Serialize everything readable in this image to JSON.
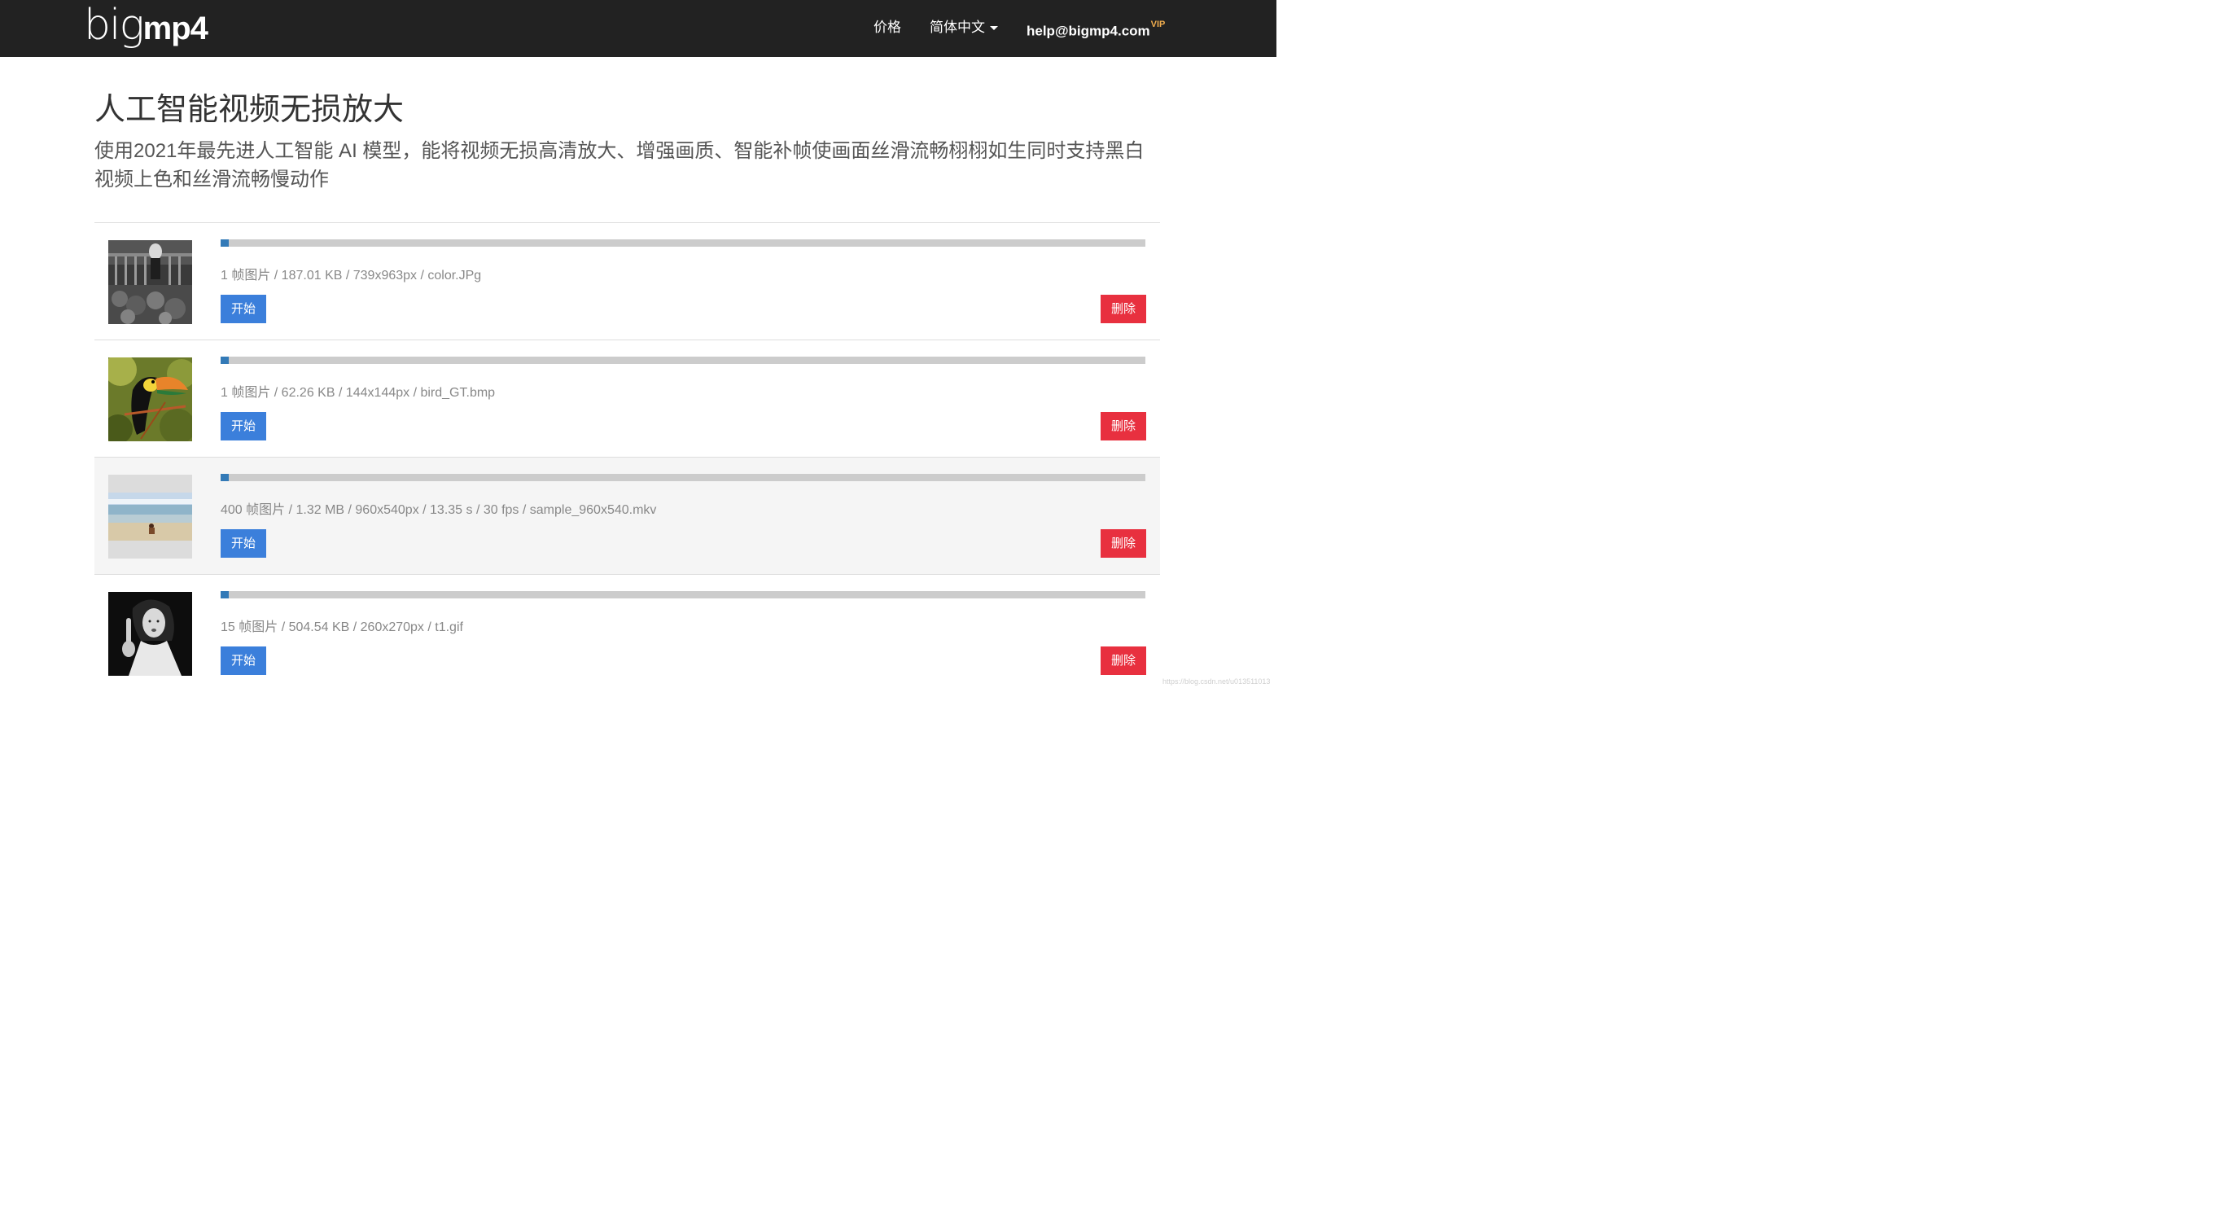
{
  "header": {
    "logo_light": "big",
    "logo_bold": "mp4",
    "nav_price": "价格",
    "nav_language": "简体中文",
    "nav_email": "help@bigmp4.com",
    "nav_email_badge": "VIP"
  },
  "main": {
    "title": "人工智能视频无损放大",
    "subtitle": "使用2021年最先进人工智能 AI 模型，能将视频无损高清放大、增强画质、智能补帧使画面丝滑流畅栩栩如生同时支持黑白视频上色和丝滑流畅慢动作"
  },
  "files": [
    {
      "meta": "1 帧图片 / 187.01 KB / 739x963px / color.JPg",
      "start_label": "开始",
      "delete_label": "删除",
      "progress": 0.009,
      "thumbnail": "black-and-white-street-photo"
    },
    {
      "meta": "1 帧图片 / 62.26 KB / 144x144px / bird_GT.bmp",
      "start_label": "开始",
      "delete_label": "删除",
      "progress": 0.009,
      "thumbnail": "toucan-bird-photo"
    },
    {
      "meta": "400 帧图片 / 1.32 MB / 960x540px / 13.35 s / 30 fps / sample_960x540.mkv",
      "start_label": "开始",
      "delete_label": "删除",
      "progress": 0.009,
      "thumbnail": "beach-video-frame"
    },
    {
      "meta": "15 帧图片 / 504.54 KB / 260x270px / t1.gif",
      "start_label": "开始",
      "delete_label": "删除",
      "progress": 0.009,
      "thumbnail": "woman-portrait-photo"
    }
  ],
  "watermark": "https://blog.csdn.net/u013511013",
  "colors": {
    "topbar": "#222222",
    "start_button": "#3b7fdb",
    "delete_button": "#e8303f",
    "progress_fill": "#337ab7",
    "progress_track": "#cccccc",
    "vip_badge": "#f0ad4e"
  }
}
